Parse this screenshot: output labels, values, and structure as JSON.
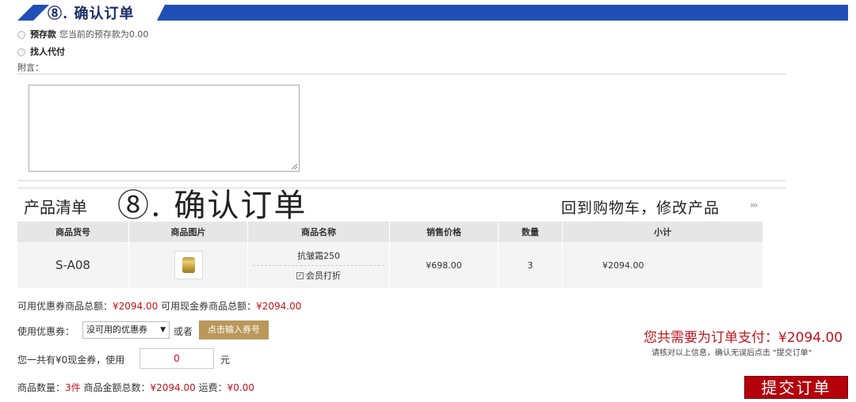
{
  "banner": {
    "title": "⑧. 确认订单"
  },
  "payment": {
    "options": [
      {
        "label": "预存款",
        "desc": "您当前的预存款为0.00"
      },
      {
        "label": "找人代付",
        "desc": ""
      }
    ],
    "remarks_label": "附言："
  },
  "section": {
    "products_label": "产品清单",
    "confirm_title": "⑧. 确认订单",
    "back_link": "回到购物车，修改产品",
    "back_arrow": "›››"
  },
  "table": {
    "headers": [
      "商品货号",
      "商品图片",
      "商品名称",
      "销售价格",
      "数量",
      "小计"
    ],
    "rows": [
      {
        "sku": "S-A08",
        "name": "抗皱霜250",
        "member": "会员打折",
        "price": "¥698.00",
        "qty": "3",
        "subtotal": "¥2094.00"
      }
    ]
  },
  "summary": {
    "coupon_total_label": "可用优惠券商品总额：",
    "coupon_total": "¥2094.00",
    "cash_total_label": "可用现金券商品总额：",
    "cash_total": "¥2094.00",
    "use_coupon_label": "使用优惠券：",
    "coupon_select": "没可用的优惠券",
    "or_label": "或者",
    "enter_code_button": "点击输入券号",
    "cash_prefix": "您一共有¥0现金券，使用",
    "cash_value": "0",
    "cash_unit": "元",
    "qty_label": "商品数量：",
    "qty_value": "3件",
    "amount_label": "商品金额总数：",
    "amount_value": "¥2094.00",
    "shipping_label": "运费：",
    "shipping_value": "¥0.00"
  },
  "checkout": {
    "total_text": "您共需要为订单支付：¥2094.00",
    "note": "请核对以上信息，确认无误后点击 \"提交订单\"",
    "submit_label": "提交订单"
  },
  "colors": {
    "banner": "#1f4fb4",
    "accent_red": "#c0141b",
    "submit_bg": "#b4000b",
    "code_button": "#b9985a"
  }
}
